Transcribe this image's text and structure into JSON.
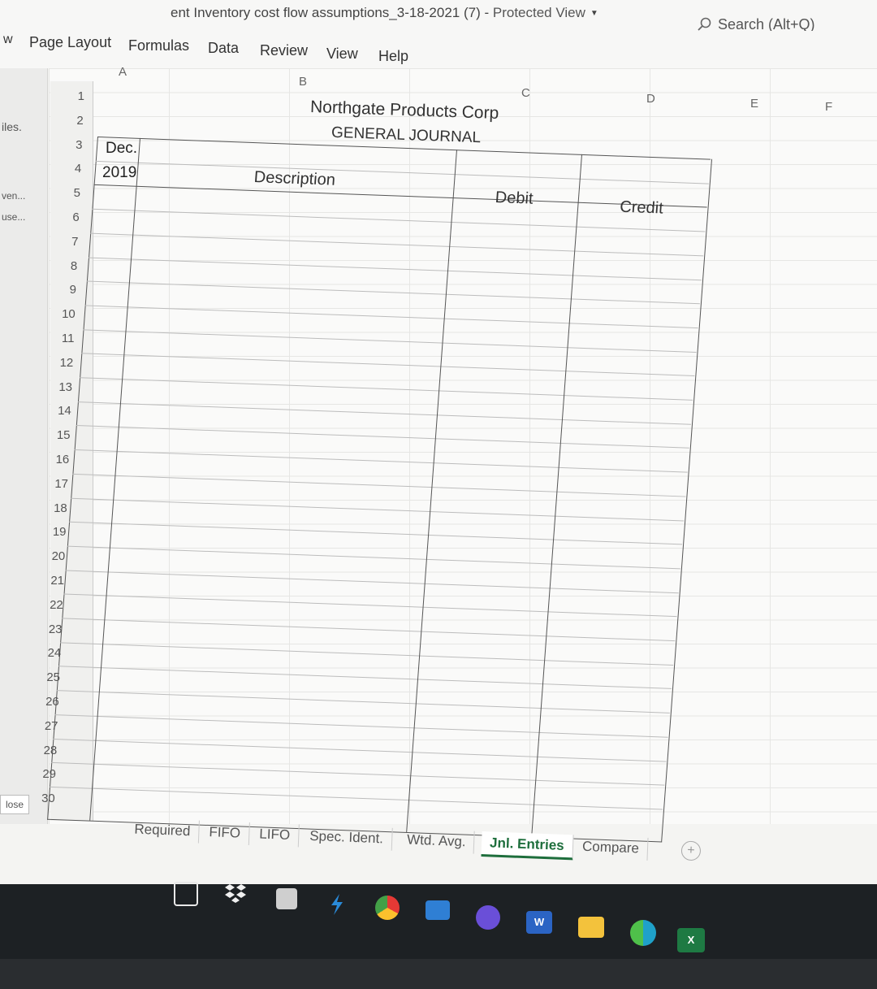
{
  "window": {
    "title": "ent Inventory cost flow assumptions_3-18-2021 (7)",
    "separator": " - ",
    "mode": "Protected View",
    "search_placeholder": "Search (Alt+Q)"
  },
  "ribbon": {
    "tabs": [
      "w",
      "Page Layout",
      "Formulas",
      "Data",
      "Review",
      "View",
      "Help"
    ]
  },
  "left_pane": {
    "items": [
      "iles.",
      "ven...",
      "use..."
    ],
    "close_label": "lose"
  },
  "sheet": {
    "column_headers": [
      "A",
      "B",
      "C",
      "D",
      "E",
      "F"
    ],
    "row_numbers": [
      "1",
      "2",
      "3",
      "4",
      "5",
      "6",
      "7",
      "8",
      "9",
      "10",
      "11",
      "12",
      "13",
      "14",
      "15",
      "16",
      "17",
      "18",
      "19",
      "20",
      "21",
      "22",
      "23",
      "24",
      "25",
      "26",
      "27",
      "28",
      "29",
      "30"
    ],
    "cells": {
      "A3": "Dec.",
      "A4": "2019"
    },
    "company": "Northgate Products Corp",
    "journal_title": "GENERAL JOURNAL",
    "headers": {
      "description": "Description",
      "debit": "Debit",
      "credit": "Credit"
    }
  },
  "sheet_tabs": {
    "tabs": [
      "Required",
      "FIFO",
      "LIFO",
      "Spec. Ident.",
      "Wtd. Avg.",
      "Jnl. Entries",
      "Compare"
    ],
    "active": "Jnl. Entries",
    "add_label": "+"
  },
  "taskbar": {
    "apps": [
      "task-view-icon",
      "dropbox-icon",
      "store-icon",
      "app-icon",
      "chrome-icon",
      "mail-icon",
      "browser-icon",
      "word-icon",
      "file-explorer-icon",
      "edge-icon",
      "excel-icon"
    ]
  },
  "colors": {
    "accent_green": "#1e6e3c",
    "taskbar": "#1d2124"
  }
}
